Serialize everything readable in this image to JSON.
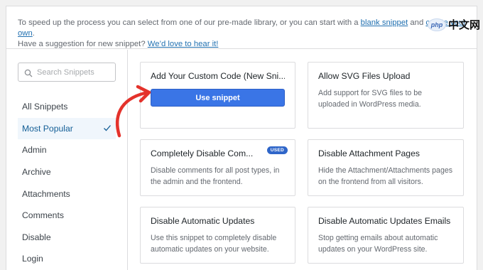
{
  "intro": {
    "line1_prefix": "To speed up the process you can select from one of our pre-made library, or you can start with a",
    "blank_snippet_link": "blank snippet",
    "and": "and",
    "create_own_link": "create your own",
    "period": ".",
    "line2_prefix": "Have a suggestion for new snippet?",
    "love_link": "We’d love to hear it!"
  },
  "search": {
    "placeholder": "Search Snippets",
    "icon": "search-icon"
  },
  "categories": [
    {
      "label": "All Snippets"
    },
    {
      "label": "Most Popular",
      "active": true
    },
    {
      "label": "Admin"
    },
    {
      "label": "Archive"
    },
    {
      "label": "Attachments"
    },
    {
      "label": "Comments"
    },
    {
      "label": "Disable"
    },
    {
      "label": "Login"
    }
  ],
  "cards": [
    {
      "title": "Add Your Custom Code (New Sni...",
      "button": "Use snippet"
    },
    {
      "title": "Allow SVG Files Upload",
      "desc": "Add support for SVG files to be uploaded in WordPress media."
    },
    {
      "title": "Completely Disable Com...",
      "badge": "USED",
      "desc": "Disable comments for all post types, in the admin and the frontend."
    },
    {
      "title": "Disable Attachment Pages",
      "desc": "Hide the Attachment/Attachments pages on the frontend from all visitors."
    },
    {
      "title": "Disable Automatic Updates",
      "desc": "Use this snippet to completely disable automatic updates on your website."
    },
    {
      "title": "Disable Automatic Updates Emails",
      "desc": "Stop getting emails about automatic updates on your WordPress site."
    }
  ],
  "watermark": {
    "logo": "php",
    "text": "中文网"
  },
  "colors": {
    "accent": "#3a75e6",
    "arrow": "#e4322b",
    "link": "#2271b1"
  }
}
